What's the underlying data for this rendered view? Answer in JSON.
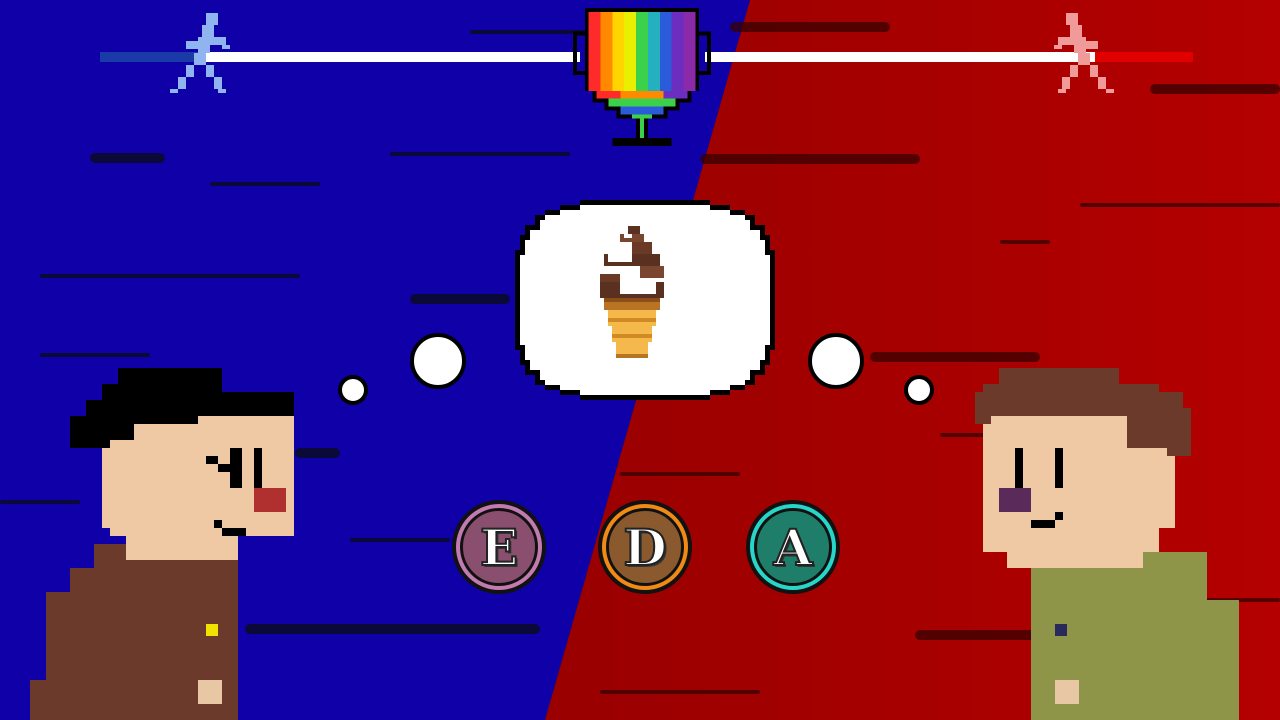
{
  "scene": {
    "left_team_color": "#0f00a8",
    "right_team_color": "#9a0000"
  },
  "progress": {
    "left_runner_icon": "runner-icon",
    "right_runner_icon": "runner-icon",
    "left_fill_color": "#1a3aa8",
    "right_fill_color": "#e00000",
    "track_color": "#ffffff"
  },
  "trophy": {
    "icon": "rainbow-trophy-icon"
  },
  "thought": {
    "item_icon": "soft-serve-ice-cream-icon"
  },
  "answers": [
    {
      "letter": "E",
      "ring_color": "#c27ab0",
      "fill_color": "#8a4f6f"
    },
    {
      "letter": "D",
      "ring_color": "#f08a14",
      "fill_color": "#8a5a2e"
    },
    {
      "letter": "A",
      "ring_color": "#27d6c8",
      "fill_color": "#1f7e6a"
    }
  ],
  "players": {
    "left": {
      "shirt_color": "#6b3a2a",
      "hair_color": "#000000"
    },
    "right": {
      "shirt_color": "#8f9548",
      "hair_color": "#6b3a2a"
    }
  }
}
